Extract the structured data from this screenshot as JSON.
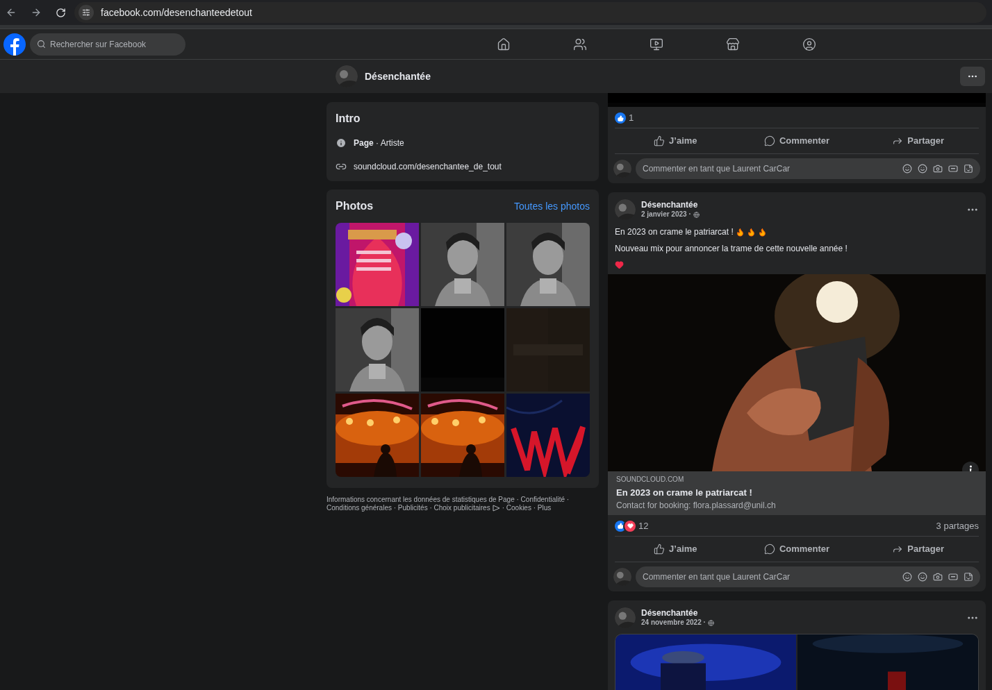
{
  "browser": {
    "url": "facebook.com/desenchanteedetout"
  },
  "topbar": {
    "search_placeholder": "Rechercher sur Facebook",
    "nav": [
      {
        "kind": "home"
      },
      {
        "kind": "friends"
      },
      {
        "kind": "video"
      },
      {
        "kind": "market"
      },
      {
        "kind": "groups"
      }
    ]
  },
  "page_header": {
    "name": "Désenchantée"
  },
  "intro": {
    "title": "Intro",
    "items": [
      {
        "kind": "info",
        "text": "**Page** · Artiste"
      },
      {
        "kind": "link",
        "text": "soundcloud.com/desenchantee_de_tout"
      }
    ]
  },
  "photos": {
    "title": "Photos",
    "link": "Toutes les photos",
    "items": [
      {
        "kind": "poster"
      },
      {
        "kind": "portrait"
      },
      {
        "kind": "portrait"
      },
      {
        "kind": "portrait"
      },
      {
        "kind": "black"
      },
      {
        "kind": "dark"
      },
      {
        "kind": "stage"
      },
      {
        "kind": "stage"
      },
      {
        "kind": "red"
      }
    ]
  },
  "footer": {
    "line_1": "Informations concernant les données de statistiques de Page · Confidentialité ·",
    "line_2": "Conditions générales · Publicités · Choix publicitaires",
    "line_2_end": "· Cookies · Plus"
  },
  "posts": [
    {
      "kind": "partial",
      "reactions": {
        "kind": "like",
        "count": "1"
      },
      "actions": [
        "J’aime",
        "Commenter",
        "Partager"
      ],
      "comment_placeholder": "Commenter en tant que Laurent CarCar"
    },
    {
      "kind": "link",
      "author": "Désenchantée",
      "date": "2 janvier 2023 ·",
      "lines": [
        {
          "kind": "fire",
          "text": "En 2023 on crame le patriarcat !"
        },
        {
          "kind": "plain",
          "text": "Nouveau mix pour annoncer la trame de cette nouvelle année !"
        },
        {
          "kind": "heart"
        }
      ],
      "preview": {
        "domain": "SOUNDCLOUD.COM",
        "title": "En 2023 on crame le patriarcat !",
        "subtitle": "Contact for booking: flora.plassard@unil.ch"
      },
      "reactions": {
        "kind": "mixed",
        "count": "12",
        "shares": "3 partages"
      },
      "actions": [
        "J’aime",
        "Commenter",
        "Partager"
      ],
      "comment_placeholder": "Commenter en tant que Laurent CarCar"
    },
    {
      "kind": "photos",
      "author": "Désenchantée",
      "date": "24 novembre 2022 ·"
    }
  ]
}
